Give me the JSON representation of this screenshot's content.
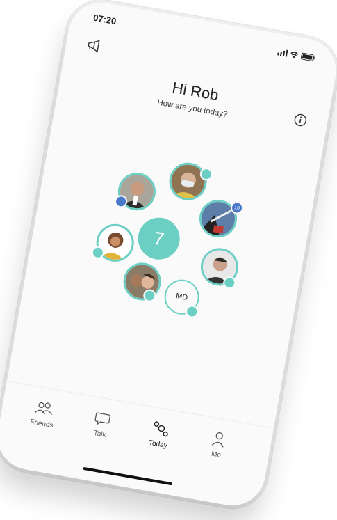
{
  "status": {
    "time": "07:20"
  },
  "header": {
    "greeting": "Hi Rob",
    "subtitle": "How are you today?"
  },
  "hub": {
    "center_count": "7",
    "friends": [
      {
        "name": "friend-1",
        "badge": ""
      },
      {
        "name": "friend-2",
        "badge": ""
      },
      {
        "name": "friend-3",
        "badge": "10"
      },
      {
        "name": "friend-4",
        "badge": ""
      },
      {
        "name": "friend-5",
        "badge": ""
      },
      {
        "name": "friend-6",
        "badge": ""
      }
    ],
    "initials_friend": {
      "initials": "MD",
      "badge": ""
    }
  },
  "tabs": [
    {
      "label": "Friends",
      "icon": "friends-icon"
    },
    {
      "label": "Talk",
      "icon": "talk-icon"
    },
    {
      "label": "Today",
      "icon": "today-icon"
    },
    {
      "label": "Me",
      "icon": "me-icon"
    }
  ],
  "colors": {
    "accent": "#6ccfc4",
    "badge_blue": "#4a78c9"
  }
}
